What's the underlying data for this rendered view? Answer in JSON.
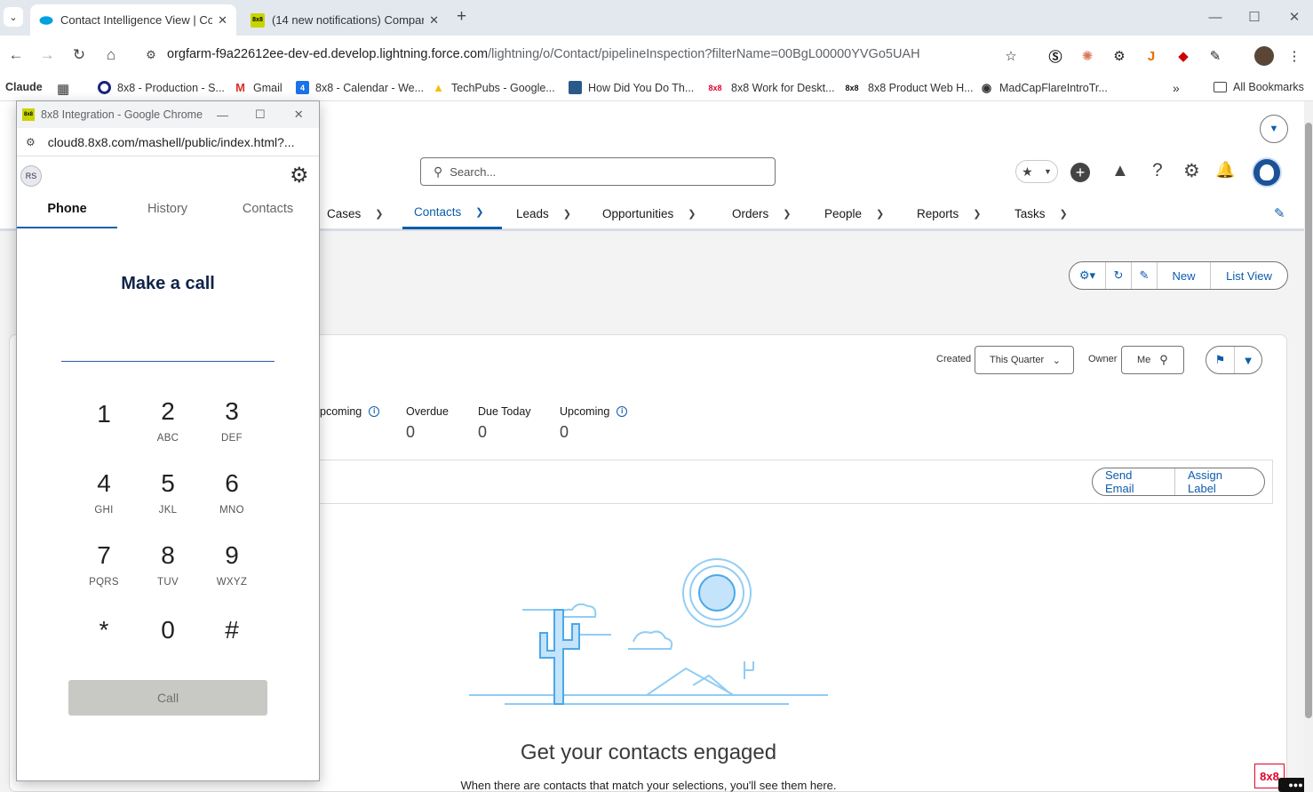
{
  "browser": {
    "tabs": [
      {
        "title": "Contact Intelligence View | Con"
      },
      {
        "title": "(14 new notifications) Company"
      }
    ],
    "new_tab": "+",
    "url_host": "orgfarm-f9a22612ee-dev-ed.develop.lightning.force.com",
    "url_path": "/lightning/o/Contact/pipelineInspection?filterName=00BgL00000YVGo5UAH",
    "bookmarks": [
      {
        "label": "Claude"
      },
      {
        "label": "8x8 - Production - S..."
      },
      {
        "label": "Gmail"
      },
      {
        "label": "8x8 - Calendar - We..."
      },
      {
        "label": "TechPubs - Google..."
      },
      {
        "label": "How Did You Do Th..."
      },
      {
        "label": "8x8 Work for Deskt..."
      },
      {
        "label": "8x8 Product Web H..."
      },
      {
        "label": "MadCapFlareIntroTr..."
      }
    ],
    "all_bookmarks": "All Bookmarks",
    "tab_icon_8x8": "8x8",
    "bookmark_badge_4": "4"
  },
  "salesforce": {
    "search_placeholder": "Search...",
    "nav": [
      {
        "label": "Cases"
      },
      {
        "label": "Contacts"
      },
      {
        "label": "Leads"
      },
      {
        "label": "Opportunities"
      },
      {
        "label": "Orders"
      },
      {
        "label": "People"
      },
      {
        "label": "Reports"
      },
      {
        "label": "Tasks"
      }
    ],
    "actions": {
      "new": "New",
      "list_view": "List View"
    },
    "filters": {
      "created_label": "Created",
      "created_value": "This Quarter",
      "owner_label": "Owner",
      "owner_value": "Me"
    },
    "metrics": [
      {
        "title": "pcoming",
        "value": ""
      },
      {
        "title": "Overdue",
        "value": "0"
      },
      {
        "title": "Due Today",
        "value": "0"
      },
      {
        "title": "Upcoming",
        "value": "0"
      }
    ],
    "bulk": {
      "send_email": "Send Email",
      "assign_label": "Assign Label"
    },
    "empty_title": "Get your contacts engaged",
    "empty_text": "When there are contacts that match your selections, you'll see them here.",
    "badge_8x8": "8x8"
  },
  "popup": {
    "window_title": "8x8 Integration - Google Chrome",
    "url": "cloud8.8x8.com/mashell/public/index.html?...",
    "avatar": "RS",
    "tabs": [
      {
        "label": "Phone"
      },
      {
        "label": "History"
      },
      {
        "label": "Contacts"
      }
    ],
    "heading": "Make a call",
    "keys": [
      {
        "d": "1",
        "s": ""
      },
      {
        "d": "2",
        "s": "ABC"
      },
      {
        "d": "3",
        "s": "DEF"
      },
      {
        "d": "4",
        "s": "GHI"
      },
      {
        "d": "5",
        "s": "JKL"
      },
      {
        "d": "6",
        "s": "MNO"
      },
      {
        "d": "7",
        "s": "PQRS"
      },
      {
        "d": "8",
        "s": "TUV"
      },
      {
        "d": "9",
        "s": "WXYZ"
      },
      {
        "d": "*",
        "s": ""
      },
      {
        "d": "0",
        "s": ""
      },
      {
        "d": "#",
        "s": ""
      }
    ],
    "call": "Call"
  },
  "colors": {
    "accent": "#0b5cab",
    "popup_active": "#1a5fb4"
  }
}
